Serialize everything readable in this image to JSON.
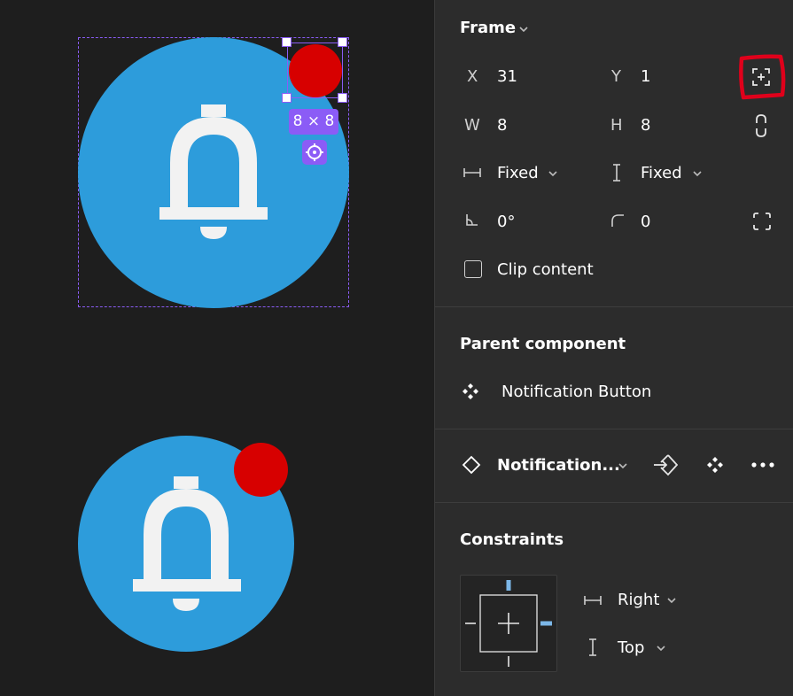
{
  "colors": {
    "canvas_bg": "#1e1e1e",
    "panel_bg": "#2c2c2c",
    "bell_circle": "#2d9cdb",
    "badge": "#d70000",
    "selection": "#8b5cf6",
    "constraint_blue": "#7cb7e8",
    "annotation_red": "#e0001b"
  },
  "canvas": {
    "selection_size_badge": "8 × 8"
  },
  "frame": {
    "title": "Frame",
    "x_label": "X",
    "x_value": "31",
    "y_label": "Y",
    "y_value": "1",
    "w_label": "W",
    "w_value": "8",
    "h_label": "H",
    "h_value": "8",
    "horizontal_resizing": "Fixed",
    "vertical_resizing": "Fixed",
    "rotation_value": "0°",
    "corner_radius_value": "0",
    "clip_content_label": "Clip content",
    "clip_content_checked": false
  },
  "parent_component": {
    "title": "Parent component",
    "name": "Notification Button"
  },
  "instance": {
    "name": "Notification..."
  },
  "constraints": {
    "title": "Constraints",
    "horizontal": "Right",
    "vertical": "Top"
  }
}
